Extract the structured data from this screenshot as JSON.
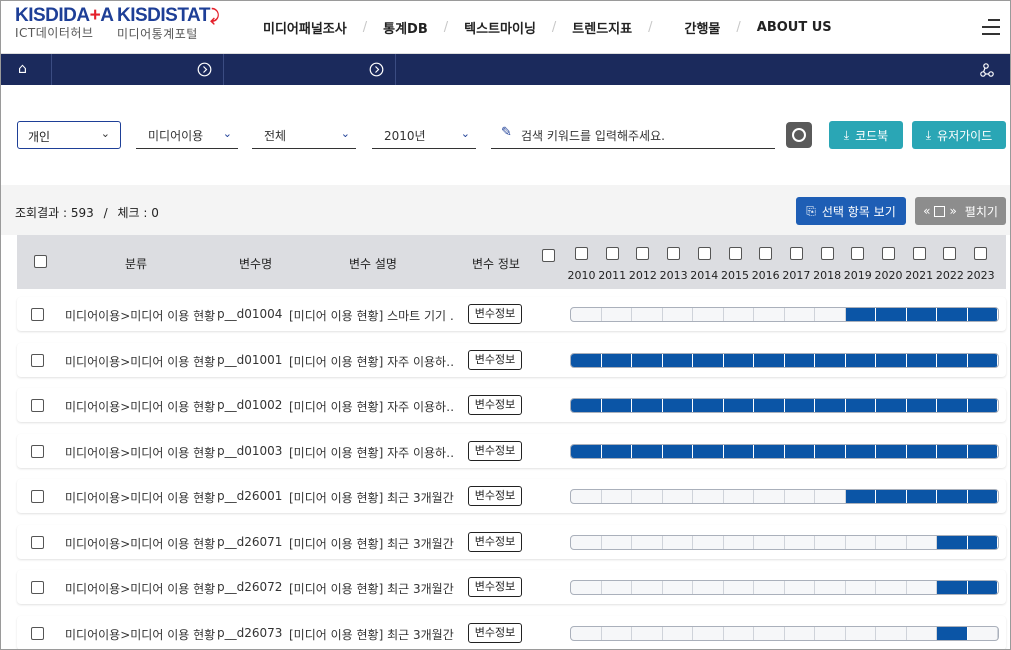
{
  "header": {
    "logo1": {
      "part_a": "KISD",
      "part_b": "IDA",
      "part_c": "+",
      "part_d": "A",
      "subtitle": "ICT데이터허브"
    },
    "logo2": {
      "part_a": "KISD",
      "part_b": "ISTAT",
      "subtitle": "미디어통계포털"
    },
    "nav": [
      "미디어패널조사",
      "통계DB",
      "텍스트마이닝",
      "트렌드지표",
      "간행물",
      "ABOUT US"
    ],
    "nav_separator": "/"
  },
  "breadcrumb_icons": [
    "home-icon",
    "arrow-circle-right-icon",
    "arrow-circle-right-icon",
    "share-icon"
  ],
  "filters": {
    "panel_type": "개인",
    "category": "미디어이용",
    "subcategory": "전체",
    "year": "2010년",
    "search_placeholder": "검색 키워드를 입력해주세요.",
    "codebook_label": "코드북",
    "userguide_label": "유저가이드"
  },
  "results": {
    "count_label": "조회결과 : 593",
    "separator": "/",
    "check_label": "체크 : 0",
    "view_selected_label": "선택 항목 보기",
    "expand_label": "펼치기",
    "expand_prefix": "«",
    "expand_suffix": "»"
  },
  "table": {
    "headers": {
      "category": "분류",
      "var_name": "변수명",
      "var_desc": "변수 설명",
      "var_info": "변수 정보"
    },
    "years": [
      "2010",
      "2011",
      "2012",
      "2013",
      "2014",
      "2015",
      "2016",
      "2017",
      "2018",
      "2019",
      "2020",
      "2021",
      "2022",
      "2023"
    ],
    "info_button_label": "변수정보",
    "rows": [
      {
        "category": "미디어이용>미디어 이용 현황",
        "var": "p__d01004",
        "desc": "[미디어 이용 현황] 스마트 기기 …",
        "filled": [
          0,
          0,
          0,
          0,
          0,
          0,
          0,
          0,
          0,
          1,
          1,
          1,
          1,
          1
        ]
      },
      {
        "category": "미디어이용>미디어 이용 현황",
        "var": "p__d01001",
        "desc": "[미디어 이용 현황] 자주 이용하…",
        "filled": [
          1,
          1,
          1,
          1,
          1,
          1,
          1,
          1,
          1,
          1,
          1,
          1,
          1,
          1
        ]
      },
      {
        "category": "미디어이용>미디어 이용 현황",
        "var": "p__d01002",
        "desc": "[미디어 이용 현황] 자주 이용하…",
        "filled": [
          1,
          1,
          1,
          1,
          1,
          1,
          1,
          1,
          1,
          1,
          1,
          1,
          1,
          1
        ]
      },
      {
        "category": "미디어이용>미디어 이용 현황",
        "var": "p__d01003",
        "desc": "[미디어 이용 현황] 자주 이용하…",
        "filled": [
          1,
          1,
          1,
          1,
          1,
          1,
          1,
          1,
          1,
          1,
          1,
          1,
          1,
          1
        ]
      },
      {
        "category": "미디어이용>미디어 이용 현황",
        "var": "p__d26001",
        "desc": "[미디어 이용 현황] 최근 3개월간…",
        "filled": [
          0,
          0,
          0,
          0,
          0,
          0,
          0,
          0,
          0,
          1,
          1,
          1,
          1,
          1
        ]
      },
      {
        "category": "미디어이용>미디어 이용 현황",
        "var": "p__d26071",
        "desc": "[미디어 이용 현황] 최근 3개월간…",
        "filled": [
          0,
          0,
          0,
          0,
          0,
          0,
          0,
          0,
          0,
          0,
          0,
          0,
          1,
          1
        ]
      },
      {
        "category": "미디어이용>미디어 이용 현황",
        "var": "p__d26072",
        "desc": "[미디어 이용 현황] 최근 3개월간…",
        "filled": [
          0,
          0,
          0,
          0,
          0,
          0,
          0,
          0,
          0,
          0,
          0,
          0,
          1,
          1
        ]
      },
      {
        "category": "미디어이용>미디어 이용 현황",
        "var": "p__d26073",
        "desc": "[미디어 이용 현황] 최근 3개월간…",
        "filled": [
          0,
          0,
          0,
          0,
          0,
          0,
          0,
          0,
          0,
          0,
          0,
          0,
          1,
          0
        ]
      }
    ]
  },
  "colors": {
    "navy": "#1b2a5c",
    "brand_blue": "#1e3f97",
    "teal": "#2aa6b5",
    "bar_fill": "#0b55a6",
    "header_gray": "#dcdde1"
  }
}
